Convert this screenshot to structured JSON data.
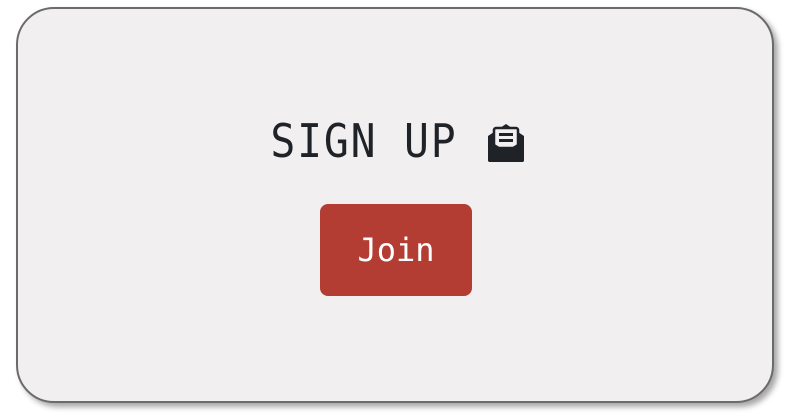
{
  "card": {
    "title": "SIGN UP",
    "title_icon": "envelope-open-text-icon",
    "join_label": "Join"
  },
  "colors": {
    "card_background": "#f1eff0",
    "card_border": "#6b6b6b",
    "button_background": "#b33c33",
    "button_text": "#ffffff",
    "title_text": "#1f2328"
  }
}
